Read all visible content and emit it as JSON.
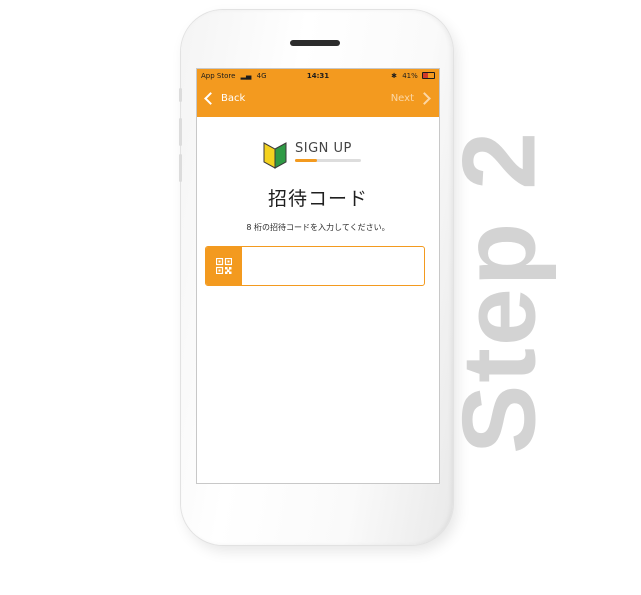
{
  "status_bar": {
    "carrier": "App Store",
    "signal_icon": "signal-bars-icon",
    "network": "4G",
    "time": "14:31",
    "bluetooth_icon": "bluetooth-icon",
    "battery": "41%",
    "battery_level": 0.41,
    "battery_color": "#d23a2a"
  },
  "nav": {
    "back_label": "Back",
    "next_label": "Next",
    "color": "#f39a1f"
  },
  "signup": {
    "icon": "beginner-mark-icon",
    "title": "SIGN UP",
    "progress": 0.33
  },
  "main": {
    "heading": "招待コード",
    "instruction": "8 桁の招待コードを入力してください。",
    "input_value": "",
    "qr_icon": "qr-code-icon"
  },
  "step_label": "Step 2"
}
